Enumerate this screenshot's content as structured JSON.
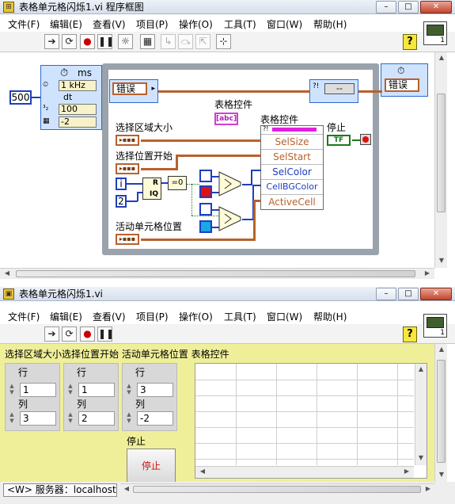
{
  "diagram_window": {
    "title": "表格单元格闪烁1.vi 程序框图",
    "menu": [
      "文件(F)",
      "编辑(E)",
      "查看(V)",
      "项目(P)",
      "操作(O)",
      "工具(T)",
      "窗口(W)",
      "帮助(H)"
    ],
    "help_label": "?",
    "loop_config": {
      "header_label": "ms",
      "period_input": "500",
      "source_value": "1 kHz",
      "dt_label": "dt",
      "priority_value": "100",
      "offset_value": "-2"
    },
    "error_in_label": "错误",
    "error_out_label": "错误",
    "error_tunnel_value": "--",
    "table_control_label": "表格控件",
    "table_control_terminal": "[abc]",
    "property_node_title": "表格控件",
    "properties": [
      "SelSize",
      "SelStart",
      "SelColor",
      "CellBGColor",
      "ActiveCell"
    ],
    "stop_label": "停止",
    "stop_terminal": "TF",
    "labels": {
      "sel_size": "选择区域大小",
      "sel_start": "选择位置开始",
      "active_cell": "活动单元格位置"
    },
    "loop_index": "i",
    "const_two": "2",
    "quotient_top": "R",
    "quotient_bottom": "IQ",
    "equal_zero": "=0"
  },
  "panel_window": {
    "title": "表格单元格闪烁1.vi",
    "menu": [
      "文件(F)",
      "编辑(E)",
      "查看(V)",
      "项目(P)",
      "操作(O)",
      "工具(T)",
      "窗口(W)",
      "帮助(H)"
    ],
    "help_label": "?",
    "header_labels": "选择区域大小选择位置开始 活动单元格位置 表格控件",
    "clusters": [
      {
        "row_label": "行",
        "row_value": "1",
        "col_label": "列",
        "col_value": "3"
      },
      {
        "row_label": "行",
        "row_value": "1",
        "col_label": "列",
        "col_value": "2"
      },
      {
        "row_label": "行",
        "row_value": "3",
        "col_label": "列",
        "col_value": "-2"
      }
    ],
    "stop_label": "停止",
    "stop_button": "停止",
    "status_server": "<W> 服务器：localhost"
  },
  "colors": {
    "wire_error": "#b8612c",
    "wire_numeric": "#1e3fbf",
    "wire_boolean": "#1b7a1b",
    "panel_bg": "#efef9a",
    "red_box": "#e01010",
    "cyan_box": "#1aa7e6"
  }
}
